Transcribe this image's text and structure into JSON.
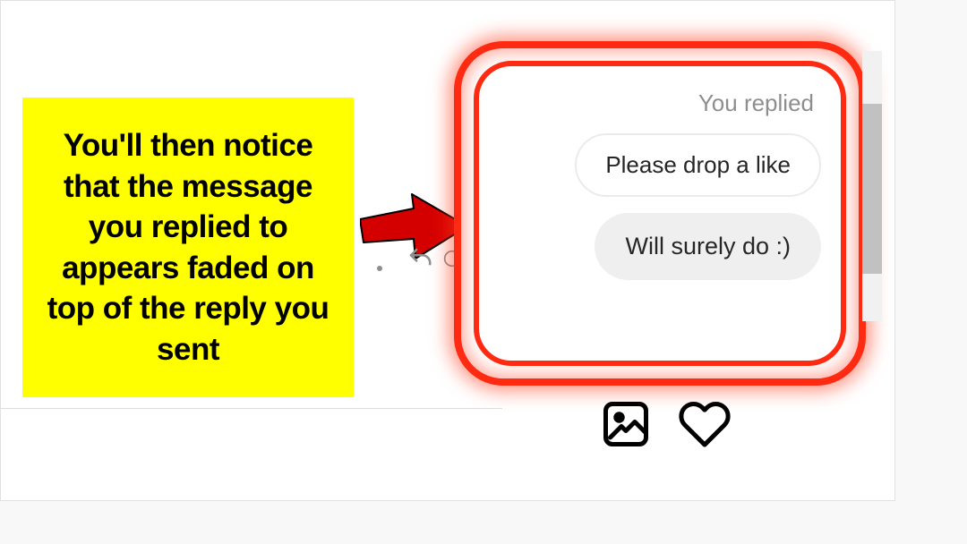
{
  "callout": {
    "text": "You'll then notice that the message you replied to appears faded on top of the reply you sent"
  },
  "chat": {
    "reply_indicator": "You replied",
    "quoted_message": "Please drop a like",
    "reply_message": "Will surely do :)"
  },
  "icons": {
    "reply": "reply-icon",
    "emoji": "emoji-icon",
    "gallery": "gallery-icon",
    "heart": "heart-icon"
  }
}
